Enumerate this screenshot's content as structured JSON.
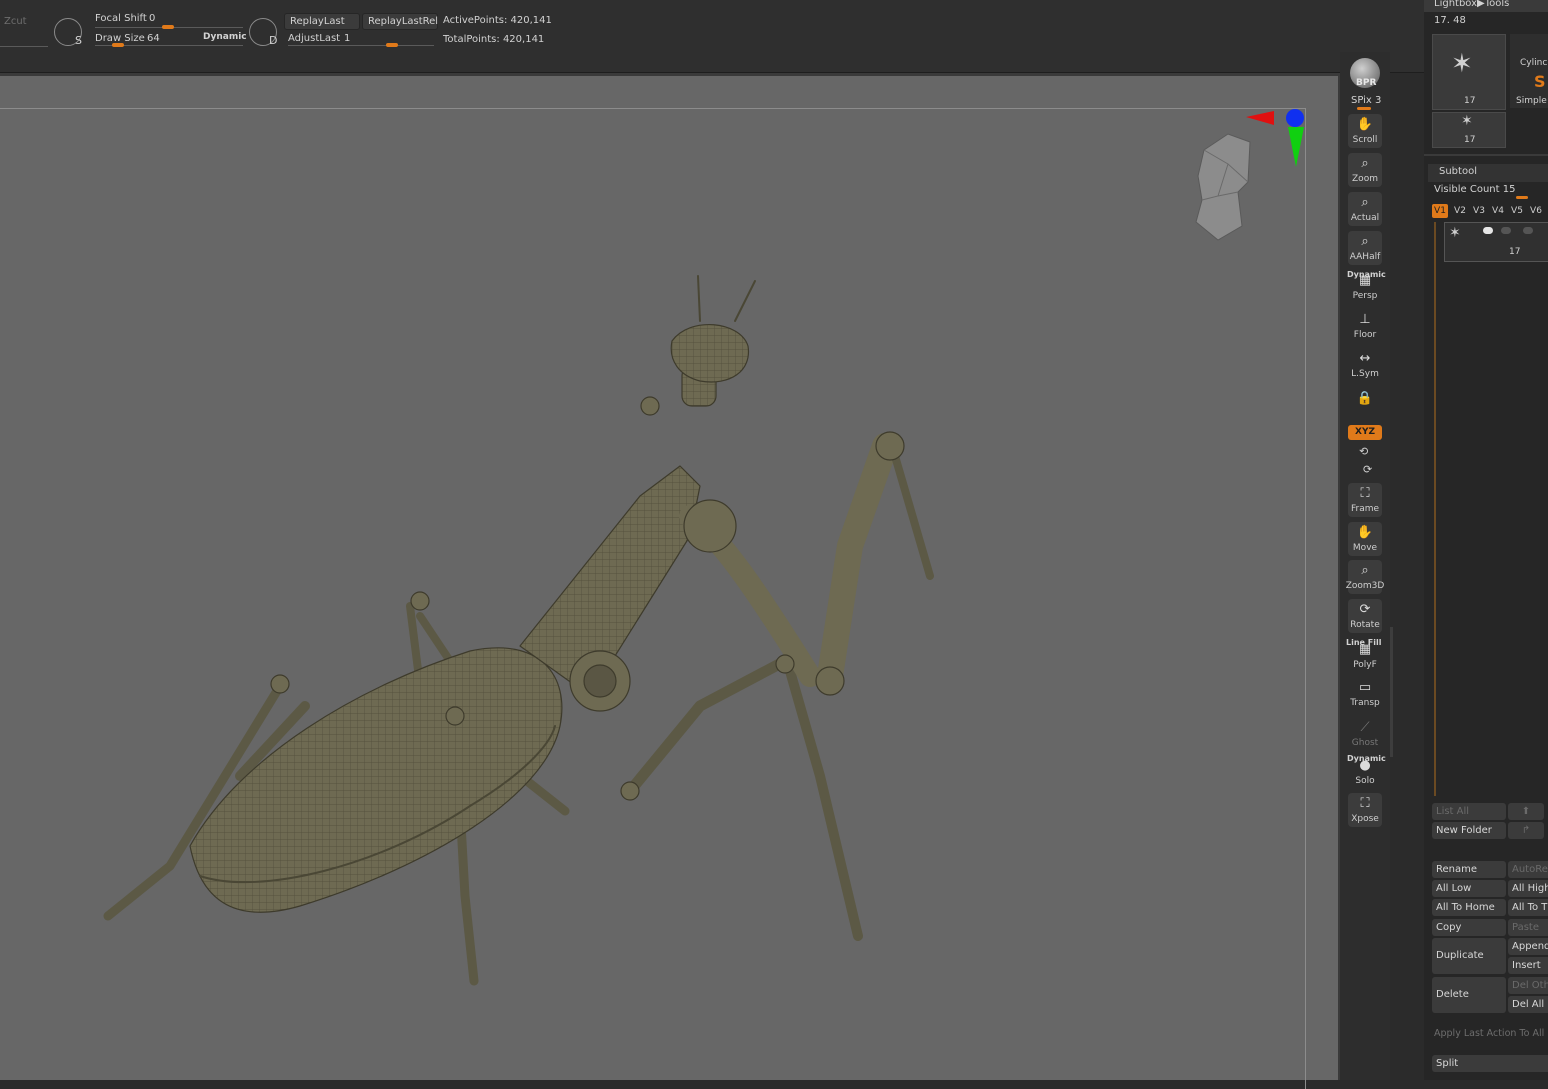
{
  "topbar": {
    "zcut_label": "Zcut",
    "focal_shift_label": "Focal Shift",
    "focal_shift_value": "0",
    "draw_size_label": "Draw Size",
    "draw_size_value": "64",
    "dynamic_label": "Dynamic",
    "s_key": "S",
    "d_key": "D",
    "replay_last": "ReplayLast",
    "replay_last_rel": "ReplayLastRel",
    "adjust_last_label": "AdjustLast",
    "adjust_last_value": "1",
    "active_points": "ActivePoints: 420,141",
    "total_points": "TotalPoints: 420,141"
  },
  "shelf": {
    "bpr": "BPR",
    "spix": "SPix 3",
    "scroll": "Scroll",
    "zoom": "Zoom",
    "actual": "Actual",
    "aahalf": "AAHalf",
    "dynamic_tag": "Dynamic",
    "persp": "Persp",
    "floor": "Floor",
    "lsym": "L.Sym",
    "xyz": "XYZ",
    "frame": "Frame",
    "move": "Move",
    "zoom3d": "Zoom3D",
    "rotate": "Rotate",
    "line_fill": "Line Fill",
    "polyf": "PolyF",
    "transp": "Transp",
    "ghost": "Ghost",
    "solo": "Solo",
    "xpose": "Xpose"
  },
  "tools": {
    "header": "Lightbox▶Tools",
    "current": "17. 48",
    "thumb1_num": "17",
    "thumb2_label": "Cylinc",
    "thumb2_sub": "Simple",
    "thumb3_num": "17"
  },
  "subtool": {
    "title": "Subtool",
    "visible_count": "Visible Count 15",
    "tabs": [
      "V1",
      "V2",
      "V3",
      "V4",
      "V5",
      "V6"
    ],
    "item_num": "17",
    "list_all": "List All",
    "new_folder": "New Folder",
    "rename": "Rename",
    "autore": "AutoRe",
    "all_low": "All Low",
    "all_high": "All High",
    "all_to_home": "All To Home",
    "all_to": "All To T",
    "copy": "Copy",
    "paste": "Paste",
    "duplicate": "Duplicate",
    "append": "Append",
    "insert": "Insert",
    "delete": "Delete",
    "del_other": "Del Oth",
    "del_all": "Del All",
    "apply_last": "Apply Last Action To All",
    "split": "Split"
  },
  "colors": {
    "accent": "#e07a1a",
    "canvas": "#676767",
    "panel": "#262626",
    "model": "#6e6a52"
  }
}
